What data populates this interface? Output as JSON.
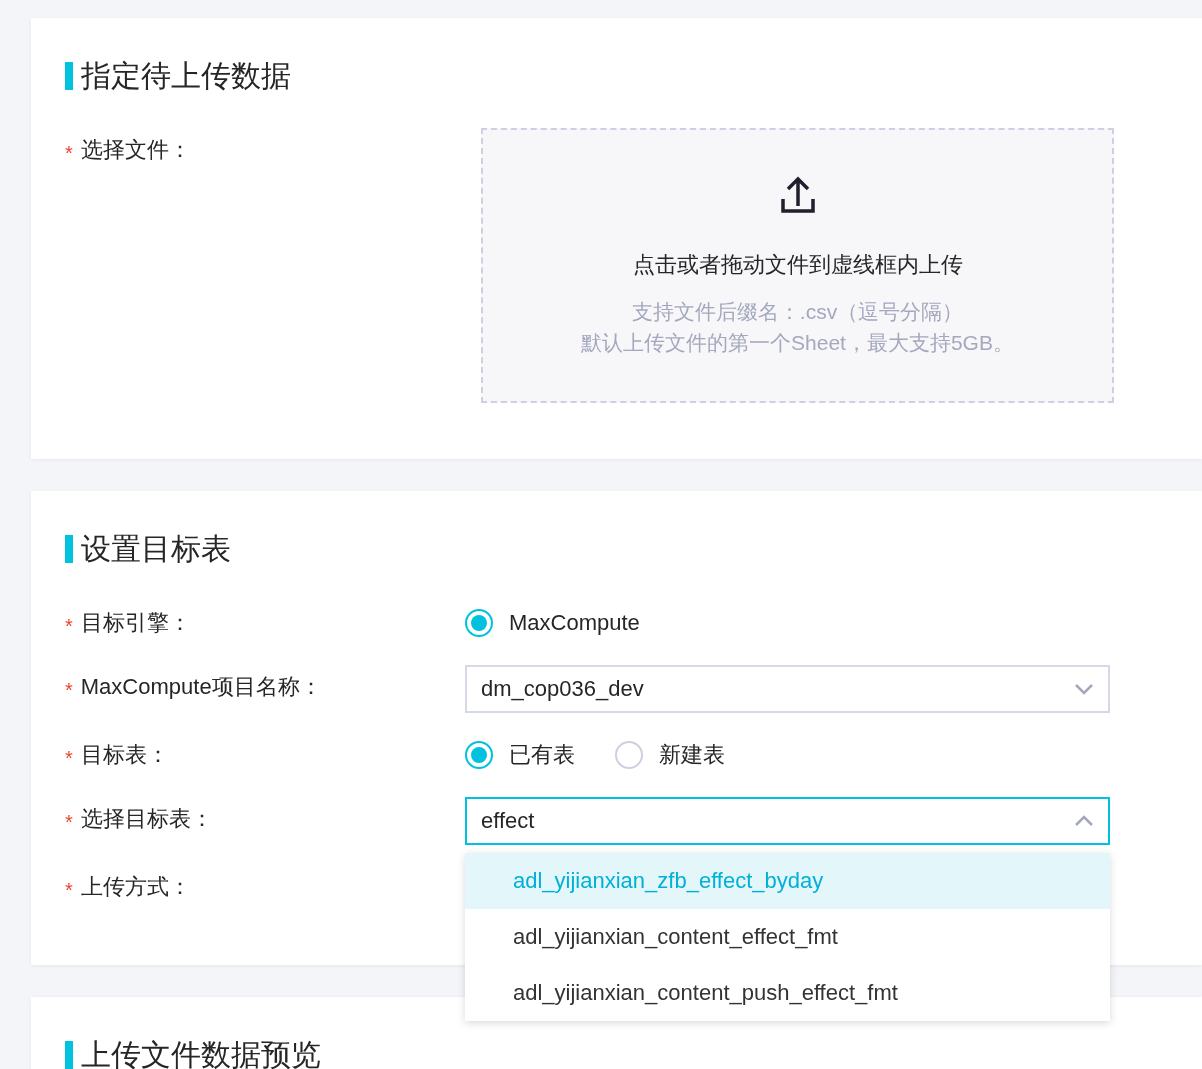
{
  "sections": [
    {
      "title": "指定待上传数据",
      "fields": [
        {
          "kind": "upload",
          "label": "选择文件：",
          "required_mark": "*",
          "prompt": "点击或者拖动文件到虚线框内上传",
          "hints": [
            "支持文件后缀名：.csv（逗号分隔）",
            "默认上传文件的第一个Sheet，最大支持5GB。"
          ]
        }
      ]
    },
    {
      "title": "设置目标表",
      "fields": [
        {
          "kind": "radio",
          "label": "目标引擎：",
          "required_mark": "*",
          "options": [
            {
              "label": "MaxCompute",
              "selected": true
            }
          ]
        },
        {
          "kind": "select",
          "label": "MaxCompute项目名称：",
          "required_mark": "*",
          "value": "dm_cop036_dev",
          "expanded": false
        },
        {
          "kind": "radio",
          "label": "目标表：",
          "required_mark": "*",
          "options": [
            {
              "label": "已有表",
              "selected": true
            },
            {
              "label": "新建表",
              "selected": false
            }
          ]
        },
        {
          "kind": "select",
          "label": "选择目标表：",
          "required_mark": "*",
          "value": "effect",
          "expanded": true,
          "options": [
            {
              "label": "adl_yijianxian_zfb_effect_byday",
              "selected": true
            },
            {
              "label": "adl_yijianxian_content_effect_fmt",
              "selected": false
            },
            {
              "label": "adl_yijianxian_content_push_effect_fmt",
              "selected": false
            }
          ]
        },
        {
          "kind": "empty",
          "label": "上传方式：",
          "required_mark": "*"
        }
      ]
    },
    {
      "title": "上传文件数据预览"
    }
  ]
}
